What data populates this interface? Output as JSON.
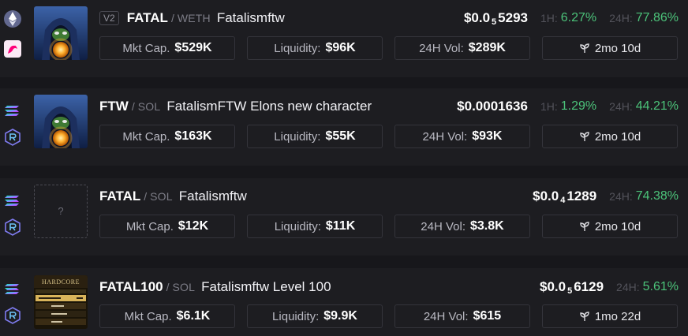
{
  "tokens": [
    {
      "chain": "ethereum",
      "dex": "uniswap-icon",
      "version": "V2",
      "symbol": "FATAL",
      "quote": "WETH",
      "name": "Fatalismftw",
      "price": {
        "prefix": "$0.0",
        "zeros": "5",
        "digits": "5293"
      },
      "change_1h_label": "1H:",
      "change_1h": "6.27%",
      "change_24h_label": "24H:",
      "change_24h": "77.86%",
      "mkt_cap_label": "Mkt Cap.",
      "mkt_cap": "$529K",
      "liquidity_label": "Liquidity:",
      "liquidity": "$96K",
      "vol_label": "24H Vol:",
      "vol": "$289K",
      "age": "2mo 10d",
      "thumb": "hooded-figure-image"
    },
    {
      "chain": "solana",
      "dex": "raydium-icon",
      "symbol": "FTW",
      "quote": "SOL",
      "name": "FatalismFTW Elons new character",
      "price": {
        "text": "$0.0001636"
      },
      "change_1h_label": "1H:",
      "change_1h": "1.29%",
      "change_24h_label": "24H:",
      "change_24h": "44.21%",
      "mkt_cap_label": "Mkt Cap.",
      "mkt_cap": "$163K",
      "liquidity_label": "Liquidity:",
      "liquidity": "$55K",
      "vol_label": "24H Vol:",
      "vol": "$93K",
      "age": "2mo 10d",
      "thumb": "hooded-figure-image"
    },
    {
      "chain": "solana",
      "dex": "raydium-icon",
      "symbol": "FATAL",
      "quote": "SOL",
      "name": "Fatalismftw",
      "price": {
        "prefix": "$0.0",
        "zeros": "4",
        "digits": "1289"
      },
      "change_24h_label": "24H:",
      "change_24h": "74.38%",
      "mkt_cap_label": "Mkt Cap.",
      "mkt_cap": "$12K",
      "liquidity_label": "Liquidity:",
      "liquidity": "$11K",
      "vol_label": "24H Vol:",
      "vol": "$3.8K",
      "age": "2mo 10d",
      "thumb_placeholder": "?"
    },
    {
      "chain": "solana",
      "dex": "raydium-icon",
      "symbol": "FATAL100",
      "quote": "SOL",
      "name": "Fatalismftw Level 100",
      "price": {
        "prefix": "$0.0",
        "zeros": "5",
        "digits": "6129"
      },
      "change_24h_label": "24H:",
      "change_24h": "5.61%",
      "mkt_cap_label": "Mkt Cap.",
      "mkt_cap": "$6.1K",
      "liquidity_label": "Liquidity:",
      "liquidity": "$9.9K",
      "vol_label": "24H Vol:",
      "vol": "$615",
      "age": "1mo 22d",
      "thumb": "hardcore-leaderboard-image",
      "thumb_title": "HARDCORE"
    }
  ],
  "colors": {
    "positive": "#4cc37a",
    "background": "#17171b",
    "card": "#1d1d21"
  },
  "icons": {
    "age": "sprout-icon"
  }
}
